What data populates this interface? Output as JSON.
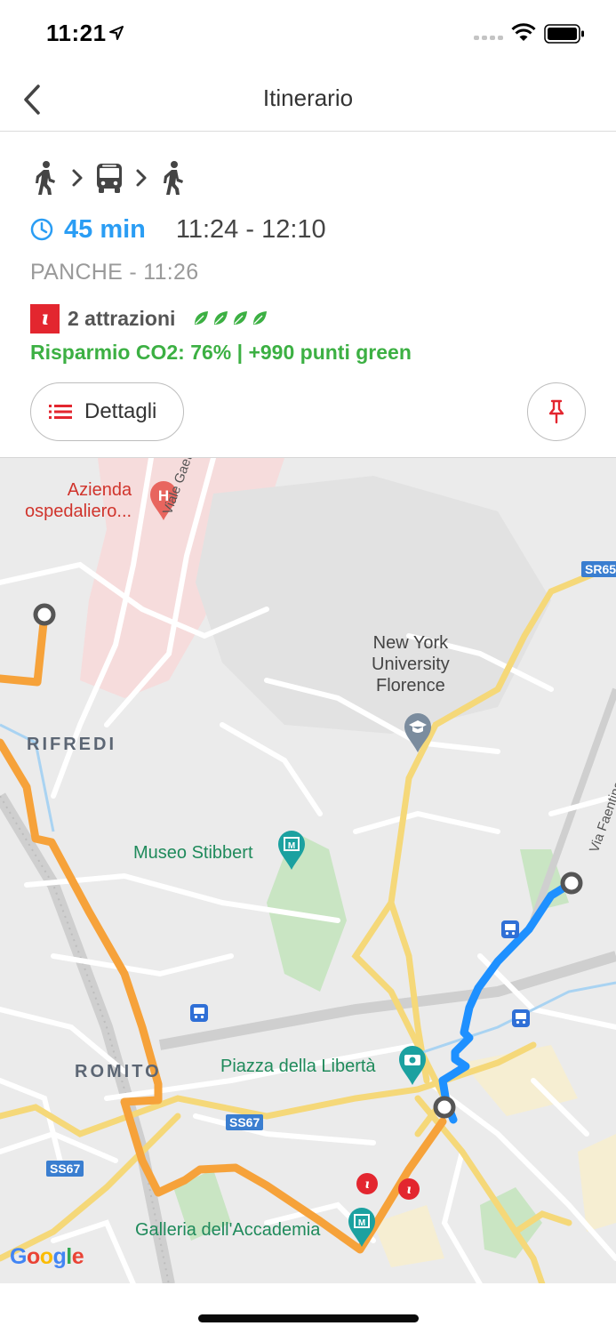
{
  "status_bar": {
    "time": "11:21"
  },
  "nav": {
    "title": "Itinerario",
    "back_icon": "chevron-left-icon"
  },
  "route": {
    "modes": [
      "walk",
      "bus",
      "walk"
    ],
    "duration": "45 min",
    "time_range": "11:24 - 12:10",
    "stop_info": "PANCHE - 11:26",
    "attractions": "2 attrazioni",
    "green_level": 4,
    "co2_savings": "Risparmio CO2: 76% | +990 punti green",
    "details_label": "Dettagli"
  },
  "map": {
    "labels": {
      "hospital": "Azienda\nospedaliero...",
      "nyu": "New York\nUniversity\nFlorence",
      "rifredi": "RIFREDI",
      "stibbert": "Museo Stibbert",
      "romito": "ROMITO",
      "liberta": "Piazza della Libertà",
      "accademia": "Galleria dell'Accademia",
      "viale": "Viale Gaetano Pieraccini",
      "faentina": "Via Faentina",
      "road_sr65": "SR65",
      "road_ss67_a": "SS67",
      "road_ss67_b": "SS67",
      "google": "Google"
    }
  },
  "colors": {
    "accent_blue": "#2a9df4",
    "green": "#3cb043",
    "red": "#e3262f",
    "route_orange": "#f6a23a",
    "route_blue": "#1e90ff"
  }
}
